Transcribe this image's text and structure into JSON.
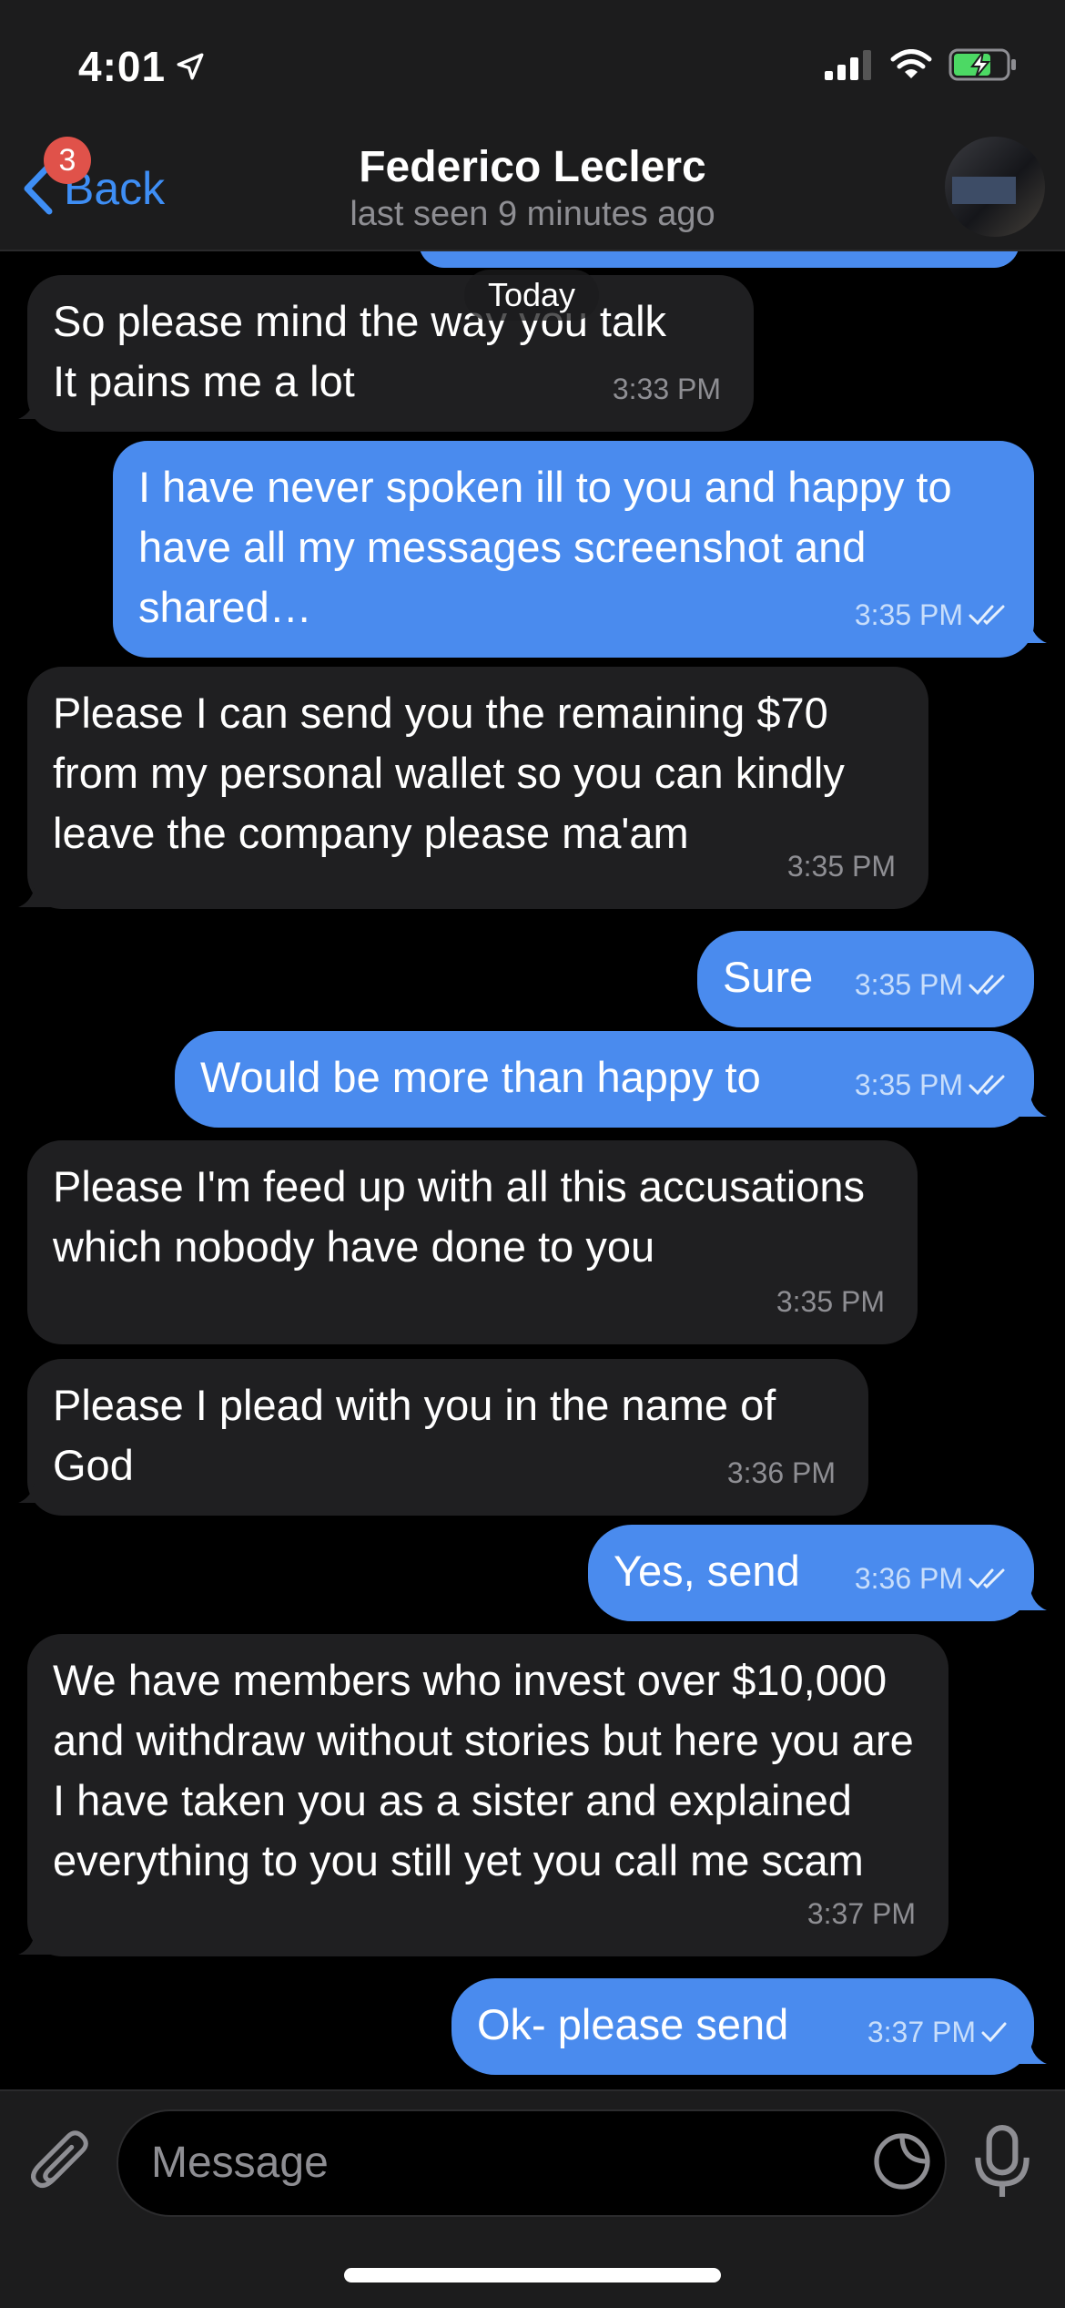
{
  "status_bar": {
    "time": "4:01"
  },
  "header": {
    "back_label": "Back",
    "unread_badge": "3",
    "contact_name": "Federico Leclerc",
    "last_seen": "last seen 9 minutes ago"
  },
  "chat": {
    "date_separator": "Today",
    "messages": [
      {
        "dir": "in",
        "text": "So please mind the way you talk\nIt pains me a lot",
        "time": "3:33 PM"
      },
      {
        "dir": "out",
        "text": "I have never spoken ill to you and happy to have all my messages screenshot and shared…",
        "time": "3:35 PM",
        "read": true
      },
      {
        "dir": "in",
        "text": "Please I can send you the remaining $70 from my personal wallet so you can kindly leave the company please ma'am",
        "time": "3:35 PM"
      },
      {
        "dir": "out",
        "text": "Sure",
        "time": "3:35 PM",
        "read": true
      },
      {
        "dir": "out",
        "text": "Would be more than happy to",
        "time": "3:35 PM",
        "read": true
      },
      {
        "dir": "in",
        "text": "Please I'm feed up with all this accusations which nobody have done to you",
        "time": "3:35 PM"
      },
      {
        "dir": "in",
        "text": "Please I plead with you in the name of God",
        "time": "3:36 PM"
      },
      {
        "dir": "out",
        "text": "Yes, send",
        "time": "3:36 PM",
        "read": true
      },
      {
        "dir": "in",
        "text": "We have members who invest over $10,000 and withdraw without stories but here you are I have taken you as a sister and explained everything to you still yet you call me scam",
        "time": "3:37 PM"
      },
      {
        "dir": "out",
        "text": "Ok- please send",
        "time": "3:37 PM",
        "read": false
      }
    ]
  },
  "input": {
    "placeholder": "Message"
  },
  "colors": {
    "accent": "#3e8ef5",
    "outgoing_bubble": "#4a8bee",
    "incoming_bubble": "#1f1f21",
    "badge": "#e0524a"
  }
}
